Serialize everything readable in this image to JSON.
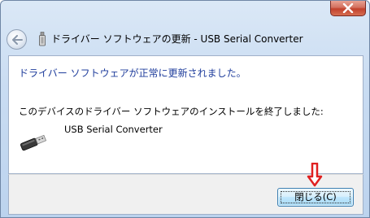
{
  "window": {
    "title": "ドライバー ソフトウェアの更新 - USB Serial Converter",
    "close_icon": "close-x-icon",
    "back_icon": "back-arrow-icon"
  },
  "content": {
    "heading": "ドライバー ソフトウェアが正常に更新されました。",
    "message": "このデバイスのドライバー ソフトウェアのインストールを終了しました:",
    "device_name": "USB Serial Converter",
    "device_icon": "usb-plug-icon"
  },
  "footer": {
    "close_button_label": "閉じる(C)"
  },
  "annotation": {
    "arrow_icon": "red-down-arrow-icon",
    "color": "#e02020"
  },
  "colors": {
    "heading": "#1f3d9c",
    "close_button_red": "#c2412c",
    "dialog_button_blue": "#bee6fd"
  }
}
